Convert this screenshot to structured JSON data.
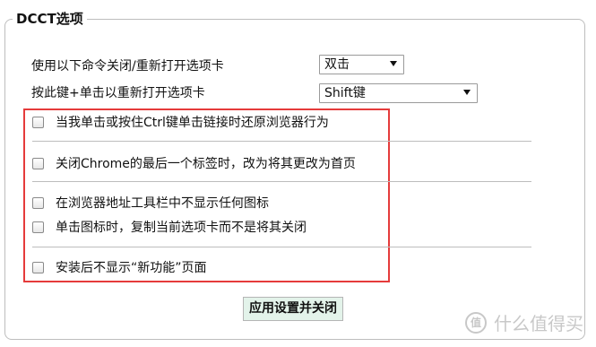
{
  "panel": {
    "legend": "DCCT选项"
  },
  "settings": {
    "close_reopen_label": "使用以下命令关闭/重新打开选项卡",
    "close_reopen_value": "双击",
    "key_click_label": "按此键+单击以重新打开选项卡",
    "key_click_value": "Shift键"
  },
  "checkboxes": [
    {
      "label": "当我单击或按住Ctrl键单击链接时还原浏览器行为",
      "checked": false
    },
    {
      "label": "关闭Chrome的最后一个标签时，改为将其更改为首页",
      "checked": false
    },
    {
      "label": "在浏览器地址工具栏中不显示任何图标",
      "checked": false
    },
    {
      "label": "单击图标时，复制当前选项卡而不是将其关闭",
      "checked": false
    },
    {
      "label": "安装后不显示“新功能”页面",
      "checked": false
    }
  ],
  "apply_button": "应用设置并关闭",
  "watermark": {
    "logo_text": "值",
    "text": "什么值得买"
  },
  "colors": {
    "highlight_border": "#e53b3b",
    "button_bg": "#e3f3ea"
  }
}
